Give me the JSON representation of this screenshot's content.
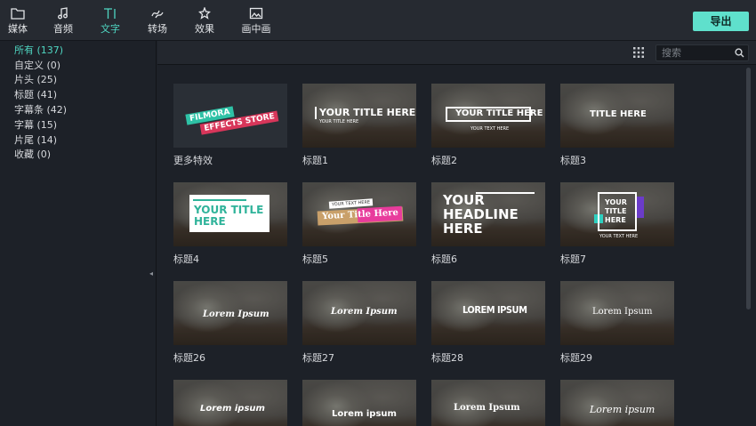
{
  "tabs": [
    {
      "label": "媒体",
      "icon": "folder-icon"
    },
    {
      "label": "音频",
      "icon": "music-note-icon"
    },
    {
      "label": "文字",
      "icon": "text-icon",
      "active": true
    },
    {
      "label": "转场",
      "icon": "transition-icon"
    },
    {
      "label": "效果",
      "icon": "effects-icon"
    },
    {
      "label": "画中画",
      "icon": "pip-icon"
    }
  ],
  "export_label": "导出",
  "categories": [
    {
      "label": "所有 (137)",
      "active": true
    },
    {
      "label": "自定义 (0)"
    },
    {
      "label": "片头 (25)"
    },
    {
      "label": "标题 (41)"
    },
    {
      "label": "字幕条 (42)"
    },
    {
      "label": "字幕 (15)"
    },
    {
      "label": "片尾 (14)"
    },
    {
      "label": "收藏 (0)"
    }
  ],
  "search": {
    "placeholder": "搜索",
    "value": ""
  },
  "cards": [
    {
      "label": "更多特效",
      "style": "store",
      "lines": [
        "FILMORA",
        "EFFECTS STORE"
      ]
    },
    {
      "label": "标题1",
      "style": "t1",
      "lines": [
        "YOUR TITLE HERE",
        "YOUR TITLE HERE"
      ]
    },
    {
      "label": "标题2",
      "style": "t2",
      "lines": [
        "YOUR TITLE HERE",
        "YOUR TEXT HERE"
      ]
    },
    {
      "label": "标题3",
      "style": "t3",
      "lines": [
        "TITLE HERE"
      ]
    },
    {
      "label": "标题4",
      "style": "t4",
      "lines": [
        "YOUR TITLE",
        "HERE"
      ]
    },
    {
      "label": "标题5",
      "style": "t5",
      "lines": [
        "YOUR TEXT HERE",
        "Your Title Here"
      ]
    },
    {
      "label": "标题6",
      "style": "t6",
      "lines": [
        "YOUR",
        "HEADLINE",
        "HERE"
      ]
    },
    {
      "label": "标题7",
      "style": "t7",
      "lines": [
        "YOUR",
        "TITLE",
        "HERE",
        "YOUR TEXT HERE"
      ]
    },
    {
      "label": "标题26",
      "style": "t26",
      "lines": [
        "Lorem Ipsum"
      ]
    },
    {
      "label": "标题27",
      "style": "t27",
      "lines": [
        "Lorem Ipsum"
      ]
    },
    {
      "label": "标题28",
      "style": "t28",
      "lines": [
        "LOREM IPSUM"
      ]
    },
    {
      "label": "标题29",
      "style": "t29",
      "lines": [
        "Lorem Ipsum"
      ]
    },
    {
      "label": "",
      "style": "r1",
      "lines": [
        "Lorem ipsum"
      ]
    },
    {
      "label": "",
      "style": "r2",
      "lines": [
        "Lorem ipsum"
      ]
    },
    {
      "label": "",
      "style": "r3",
      "lines": [
        "Lorem Ipsum"
      ]
    },
    {
      "label": "",
      "style": "r4",
      "lines": [
        "Lorem ipsum"
      ]
    }
  ]
}
